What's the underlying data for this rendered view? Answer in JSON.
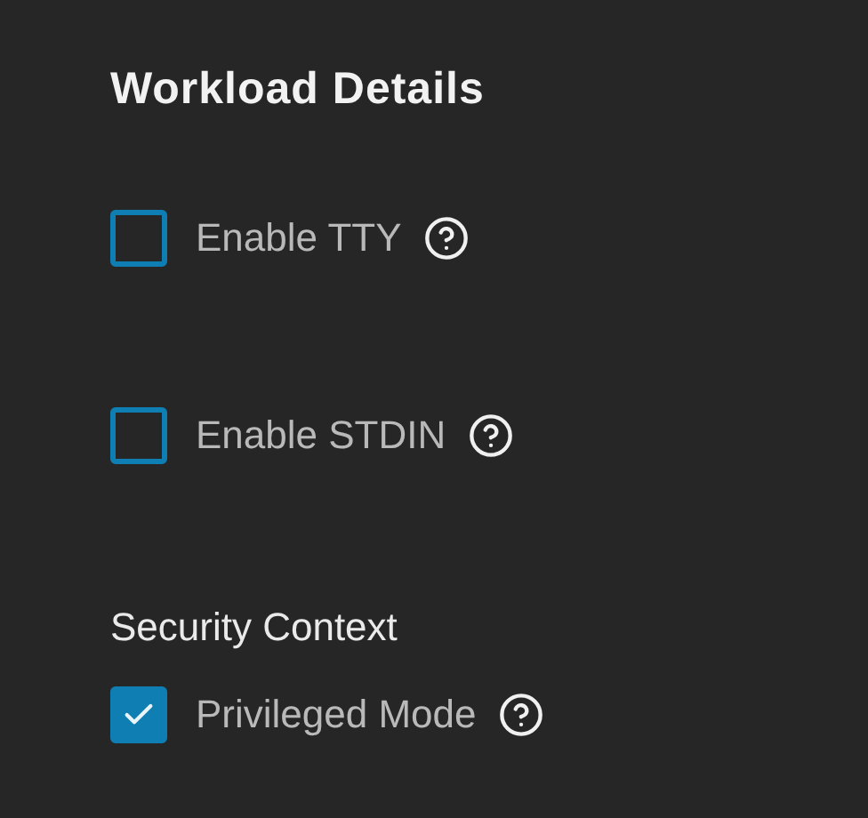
{
  "title": "Workload Details",
  "options": [
    {
      "label": "Enable TTY",
      "checked": false
    },
    {
      "label": "Enable STDIN",
      "checked": false
    }
  ],
  "security_context": {
    "heading": "Security Context",
    "options": [
      {
        "label": "Privileged Mode",
        "checked": true
      }
    ]
  }
}
